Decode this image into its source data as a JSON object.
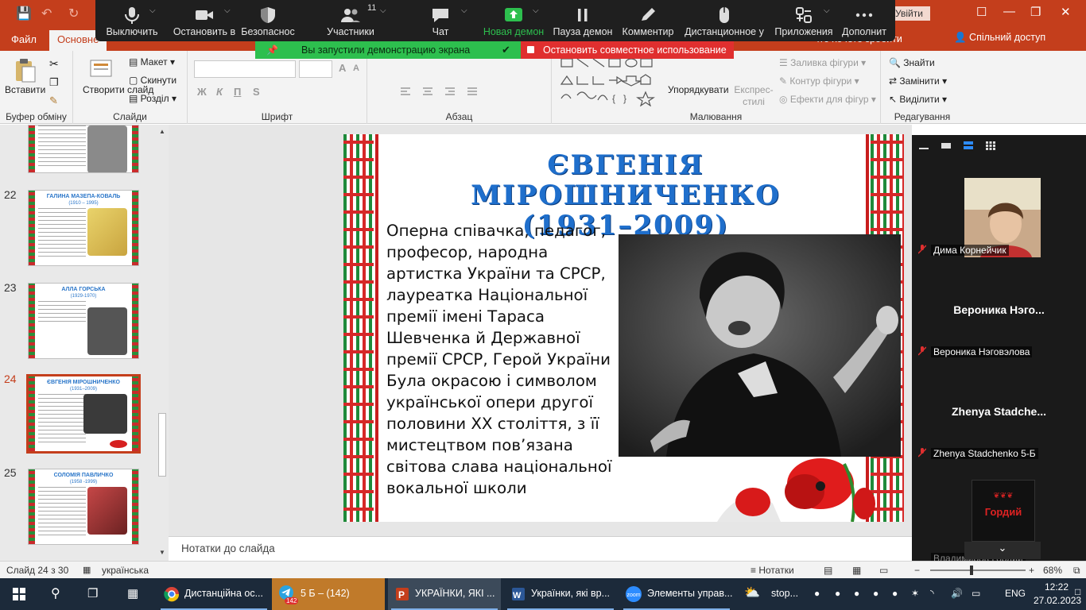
{
  "powerpoint": {
    "signin_label": "Увійти",
    "tabs": [
      "Файл",
      "Основне"
    ],
    "tell_me": "что хочете зробити",
    "share_label": "Спільний доступ",
    "ribbon": {
      "clipboard": {
        "paste": "Вставити",
        "label": "Буфер обміну"
      },
      "slides": {
        "new_slide": "Створити слайд",
        "layout": "Макет",
        "reset": "Скинути",
        "section": "Розділ",
        "label": "Слайди"
      },
      "font": {
        "label": "Шрифт",
        "bold": "Ж",
        "italic": "К",
        "underline": "П",
        "strike": "S"
      },
      "paragraph": {
        "label": "Абзац"
      },
      "drawing": {
        "arrange": "Упорядкувати",
        "quick_styles": "Експрес-стилі",
        "fill": "Заливка фігури",
        "outline": "Контур фігури",
        "effects": "Ефекти для фігур",
        "label": "Малювання"
      },
      "editing": {
        "find": "Знайти",
        "replace": "Замінити",
        "select": "Виділити",
        "label": "Редагування"
      }
    },
    "thumbnails": [
      {
        "num": "22",
        "title": "ГАЛИНА МАЗЕПА-КОВАЛЬ",
        "years": "(1910 – 1995)"
      },
      {
        "num": "23",
        "title": "АЛЛА ГОРСЬКА",
        "years": "(1929-1970)"
      },
      {
        "num": "24",
        "title": "ЄВГЕНІЯ МІРОШНИЧЕНКО",
        "years": "(1931–2009)"
      },
      {
        "num": "25",
        "title": "СОЛОМІЯ ПАВЛИЧКО",
        "years": "(1958 -1999)"
      }
    ],
    "slide": {
      "title_line1": "ЄВГЕНІЯ МІРОШНИЧЕНКО",
      "title_line2": "(1931–2009)",
      "body": "Оперна співачка, педагог, професор, народна артистка України та СРСР, лауреатка Національної премії імені Тараса Шевченка й Державної премії СРСР, Герой України Була окрасою і символом української опери другої половини ХХ століття, з її мистецтвом пов’язана світова слава національної вокальної школи"
    },
    "notes_placeholder": "Нотатки до слайда",
    "status": {
      "slide_counter": "Слайд 24 з 30",
      "language": "українська",
      "notes": "Нотатки",
      "zoom": "68%"
    }
  },
  "zoom": {
    "toolbar": [
      {
        "label": "Выключить",
        "icon": "microphone-icon"
      },
      {
        "label": "Остановить в",
        "icon": "video-camera-icon"
      },
      {
        "label": "Безопаснос",
        "icon": "shield-icon"
      },
      {
        "label": "Участники",
        "icon": "participants-icon",
        "count": "11"
      },
      {
        "label": "Чат",
        "icon": "chat-icon"
      },
      {
        "label": "Новая демон",
        "icon": "share-screen-icon"
      },
      {
        "label": "Пауза демон",
        "icon": "pause-icon"
      },
      {
        "label": "Комментир",
        "icon": "pen-icon"
      },
      {
        "label": "Дистанционное у",
        "icon": "mouse-icon"
      },
      {
        "label": "Приложения",
        "icon": "apps-icon"
      },
      {
        "label": "Дополнит",
        "icon": "more-icon"
      }
    ],
    "sharing_banner": "Вы запустили демонстрацию экрана",
    "stop_share": "Остановить совместное использование",
    "participants": [
      {
        "name": "Дима Корнейчик",
        "big": ""
      },
      {
        "name": "Вероника Нэговэлова",
        "big": "Вероника  Нэго..."
      },
      {
        "name": "Zhenya Stadchenko 5-Б",
        "big": "Zhenya  Stadche..."
      },
      {
        "name": "Владимиров Гордий",
        "big": "",
        "avatar_text": "Гордий"
      }
    ]
  },
  "taskbar": {
    "apps": [
      {
        "label": "Дистанційна ос...",
        "icon": "chrome-icon"
      },
      {
        "label": "5 Б – (142)",
        "icon": "telegram-icon",
        "badge": "142"
      },
      {
        "label": "УКРАЇНКИ, ЯКІ ...",
        "icon": "powerpoint-icon"
      },
      {
        "label": "Українки, які вр...",
        "icon": "word-icon"
      },
      {
        "label": "Элементы управ...",
        "icon": "zoom-icon"
      },
      {
        "label": "stop...",
        "icon": "weather-icon"
      }
    ],
    "lang": "ENG",
    "time": "12:22",
    "date": "27.02.2023"
  }
}
